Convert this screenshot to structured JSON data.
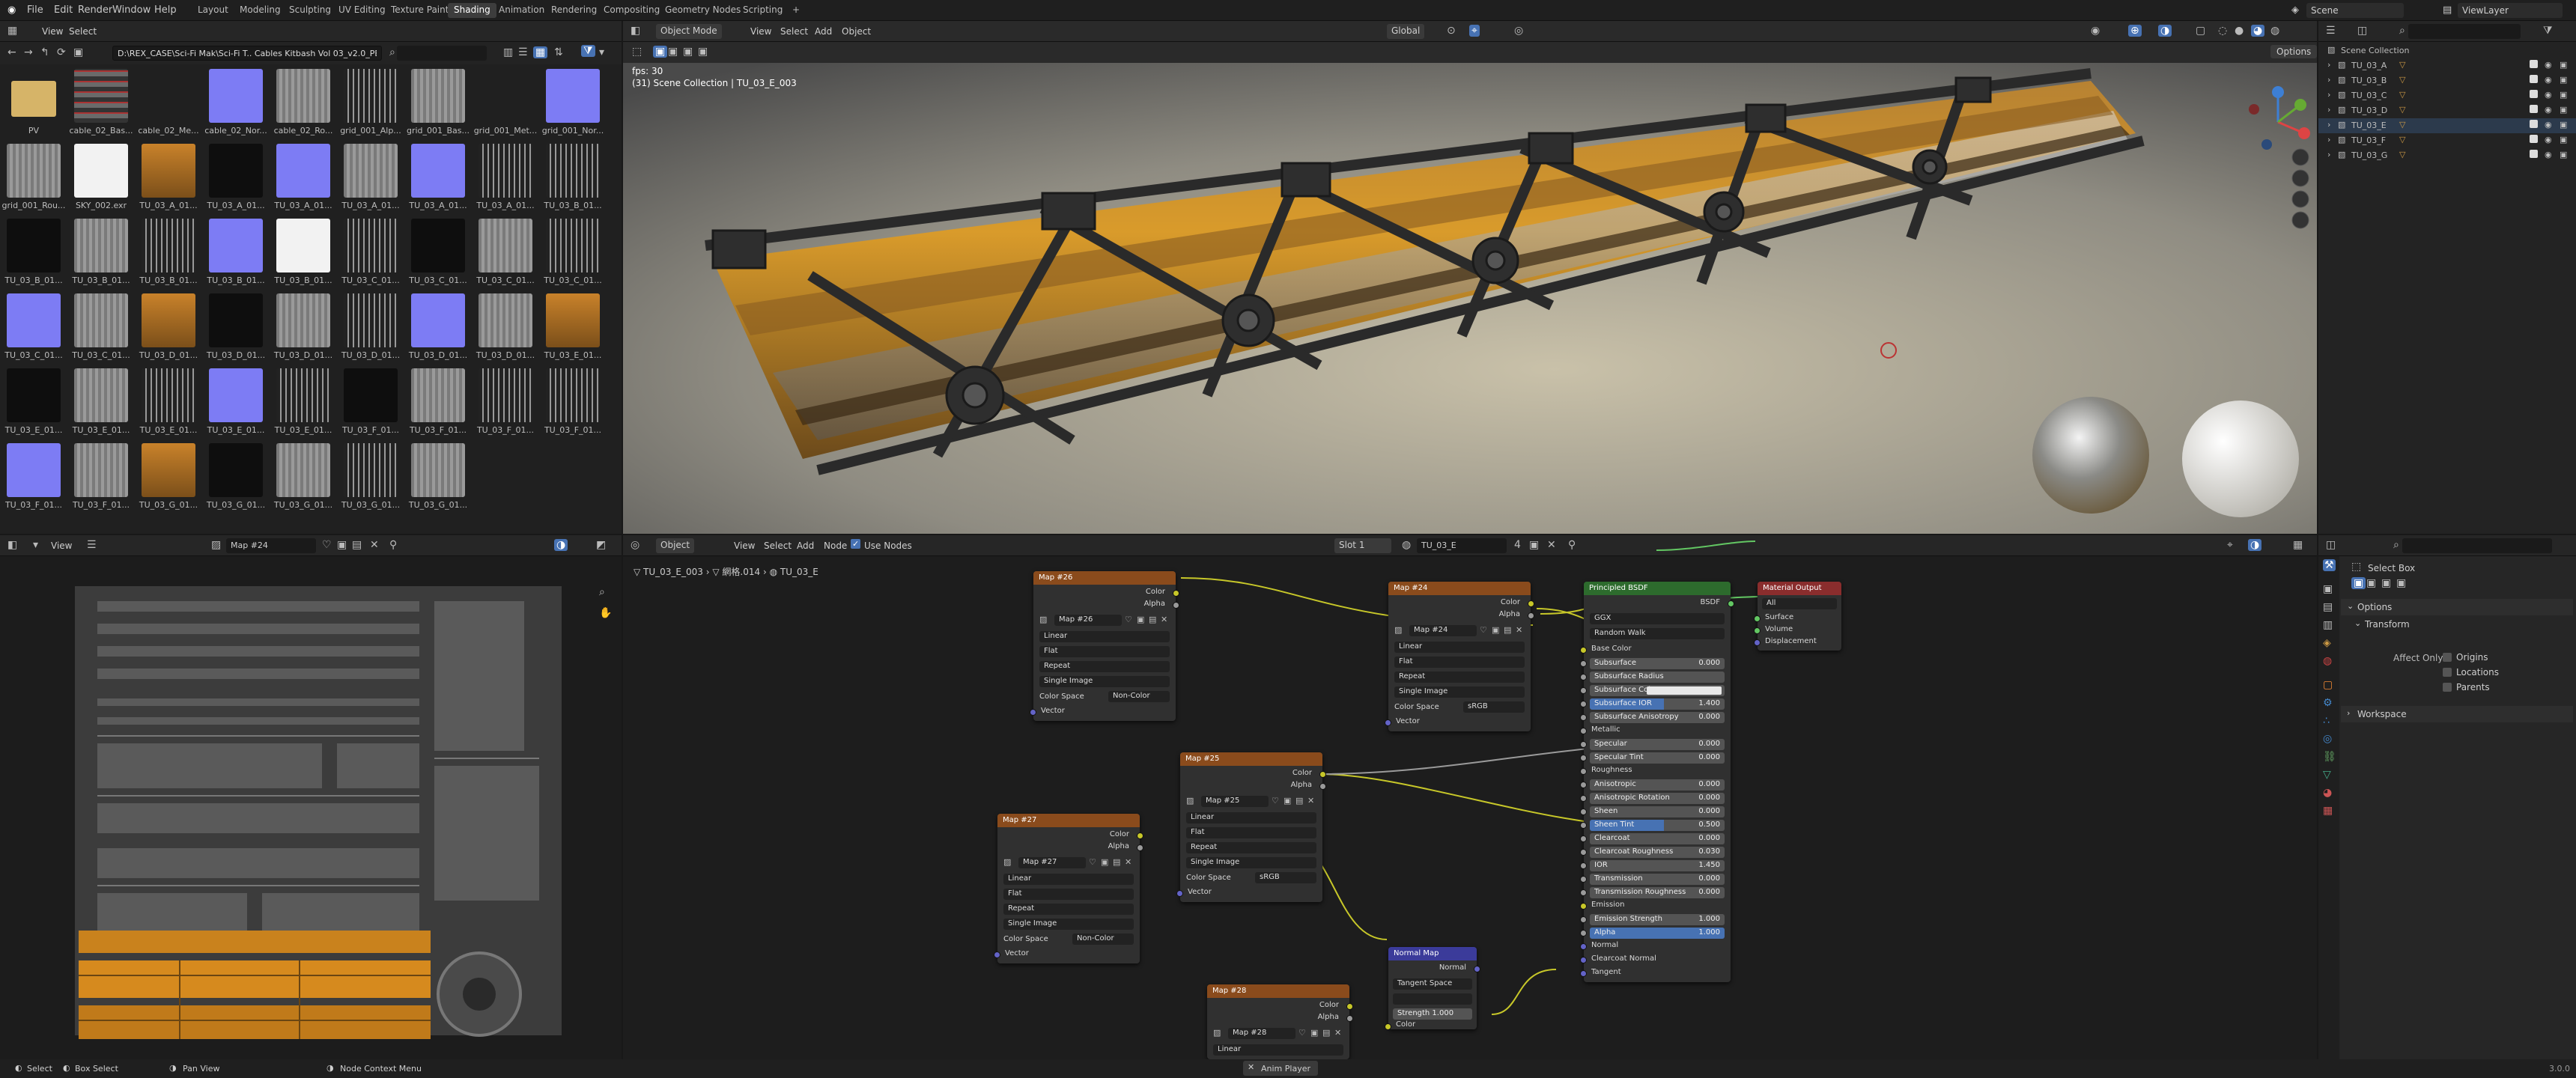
{
  "topbar": {
    "menus": [
      "File",
      "Edit",
      "Render",
      "Window",
      "Help"
    ],
    "workspaces": [
      "Layout",
      "Modeling",
      "Sculpting",
      "UV Editing",
      "Texture Paint",
      "Shading",
      "Animation",
      "Rendering",
      "Compositing",
      "Geometry Nodes",
      "Scripting"
    ],
    "active_workspace": "Shading",
    "add": "+",
    "scene": "Scene",
    "view_layer": "ViewLayer"
  },
  "filebrowser": {
    "menus": [
      "View",
      "Select"
    ],
    "path": "D:\\REX_CASE\\Sci-Fi Mak\\Sci-Fi T.. Cables Kitbash Vol 03_v2.0_PBR\\",
    "items": [
      {
        "label": "PV",
        "kind": "folder"
      },
      {
        "label": "cable_02_Bas...",
        "kind": "stripes"
      },
      {
        "label": "cable_02_Me...",
        "kind": "dark"
      },
      {
        "label": "cable_02_Nor...",
        "kind": "normal"
      },
      {
        "label": "cable_02_Ro...",
        "kind": "grey"
      },
      {
        "label": "grid_001_Alp...",
        "kind": "grid"
      },
      {
        "label": "grid_001_Bas...",
        "kind": "grey"
      },
      {
        "label": "grid_001_Met...",
        "kind": "dark"
      },
      {
        "label": "grid_001_Nor...",
        "kind": "normal"
      },
      {
        "label": "grid_001_Rou...",
        "kind": "grey"
      },
      {
        "label": "SKY_002.exr",
        "kind": "white"
      },
      {
        "label": "TU_03_A_01...",
        "kind": "orange"
      },
      {
        "label": "TU_03_A_01...",
        "kind": "black"
      },
      {
        "label": "TU_03_A_01...",
        "kind": "normal"
      },
      {
        "label": "TU_03_A_01...",
        "kind": "grey"
      },
      {
        "label": "TU_03_A_01...",
        "kind": "normal"
      },
      {
        "label": "TU_03_A_01...",
        "kind": "grid"
      },
      {
        "label": "TU_03_B_01...",
        "kind": "grid"
      },
      {
        "label": "TU_03_B_01...",
        "kind": "black"
      },
      {
        "label": "TU_03_B_01...",
        "kind": "grey"
      },
      {
        "label": "TU_03_B_01...",
        "kind": "grid"
      },
      {
        "label": "TU_03_B_01...",
        "kind": "normal"
      },
      {
        "label": "TU_03_B_01...",
        "kind": "white"
      },
      {
        "label": "TU_03_C_01...",
        "kind": "grid"
      },
      {
        "label": "TU_03_C_01...",
        "kind": "black"
      },
      {
        "label": "TU_03_C_01...",
        "kind": "grey"
      },
      {
        "label": "TU_03_C_01...",
        "kind": "grid"
      },
      {
        "label": "TU_03_C_01...",
        "kind": "normal"
      },
      {
        "label": "TU_03_C_01...",
        "kind": "grey"
      },
      {
        "label": "TU_03_D_01...",
        "kind": "orange"
      },
      {
        "label": "TU_03_D_01...",
        "kind": "black"
      },
      {
        "label": "TU_03_D_01...",
        "kind": "grey"
      },
      {
        "label": "TU_03_D_01...",
        "kind": "grid"
      },
      {
        "label": "TU_03_D_01...",
        "kind": "normal"
      },
      {
        "label": "TU_03_D_01...",
        "kind": "grey"
      },
      {
        "label": "TU_03_E_01...",
        "kind": "orange"
      },
      {
        "label": "TU_03_E_01...",
        "kind": "black"
      },
      {
        "label": "TU_03_E_01...",
        "kind": "grey"
      },
      {
        "label": "TU_03_E_01...",
        "kind": "grid"
      },
      {
        "label": "TU_03_E_01...",
        "kind": "normal"
      },
      {
        "label": "TU_03_E_01...",
        "kind": "grid"
      },
      {
        "label": "TU_03_F_01...",
        "kind": "black"
      },
      {
        "label": "TU_03_F_01...",
        "kind": "grey"
      },
      {
        "label": "TU_03_F_01...",
        "kind": "grid"
      },
      {
        "label": "TU_03_F_01...",
        "kind": "grid"
      },
      {
        "label": "TU_03_F_01...",
        "kind": "normal"
      },
      {
        "label": "TU_03_F_01...",
        "kind": "grey"
      },
      {
        "label": "TU_03_G_01...",
        "kind": "orange"
      },
      {
        "label": "TU_03_G_01...",
        "kind": "black"
      },
      {
        "label": "TU_03_G_01...",
        "kind": "grey"
      },
      {
        "label": "TU_03_G_01...",
        "kind": "grid"
      },
      {
        "label": "TU_03_G_01...",
        "kind": "grey"
      }
    ]
  },
  "viewport": {
    "mode": "Object Mode",
    "menus": [
      "View",
      "Select",
      "Add",
      "Object"
    ],
    "orientation": "Global",
    "options": "Options",
    "fps": "fps: 30",
    "collection": "(31) Scene Collection | TU_03_E_003"
  },
  "outliner": {
    "title": "Scene Collection",
    "items": [
      "TU_03_A",
      "TU_03_B",
      "TU_03_C",
      "TU_03_D",
      "TU_03_E",
      "TU_03_F",
      "TU_03_G"
    ]
  },
  "uv": {
    "view": "View",
    "image": "Map #24"
  },
  "node_editor": {
    "object": "Object",
    "menus": [
      "View",
      "Select",
      "Add",
      "Node"
    ],
    "use_nodes": "Use Nodes",
    "slot": "Slot 1",
    "material": "TU_03_E",
    "breadcrumb": [
      "TU_03_E_003",
      "網格.014",
      "TU_03_E"
    ]
  },
  "nodes": {
    "map26": {
      "title": "Map #26",
      "img": "Map #26",
      "out1": "Color",
      "out2": "Alpha",
      "interp": "Linear",
      "proj": "Flat",
      "ext": "Repeat",
      "src": "Single Image",
      "cs_label": "Color Space",
      "cs": "Non-Color",
      "vec": "Vector"
    },
    "map24": {
      "title": "Map #24",
      "img": "Map #24",
      "out1": "Color",
      "out2": "Alpha",
      "interp": "Linear",
      "proj": "Flat",
      "ext": "Repeat",
      "src": "Single Image",
      "cs_label": "Color Space",
      "cs": "sRGB",
      "vec": "Vector"
    },
    "map25": {
      "title": "Map #25",
      "img": "Map #25",
      "out1": "Color",
      "out2": "Alpha",
      "interp": "Linear",
      "proj": "Flat",
      "ext": "Repeat",
      "src": "Single Image",
      "cs_label": "Color Space",
      "cs": "sRGB",
      "vec": "Vector"
    },
    "map27": {
      "title": "Map #27",
      "img": "Map #27",
      "out1": "Color",
      "out2": "Alpha",
      "interp": "Linear",
      "proj": "Flat",
      "ext": "Repeat",
      "src": "Single Image",
      "cs_label": "Color Space",
      "cs": "Non-Color",
      "vec": "Vector"
    },
    "map28": {
      "title": "Map #28",
      "img": "Map #28",
      "out1": "Color",
      "out2": "Alpha",
      "interp": "Linear"
    },
    "normal": {
      "title": "Normal Map",
      "out": "Normal",
      "space": "Tangent Space",
      "strength_label": "Strength",
      "strength": "1.000",
      "color": "Color"
    },
    "bsdf": {
      "title": "Principled BSDF",
      "out": "BSDF",
      "dist": "GGX",
      "sss": "Random Walk",
      "base": "Base Color",
      "fields": [
        [
          "Subsurface",
          "0.000"
        ],
        [
          "Subsurface Radius",
          ""
        ],
        [
          "Subsurface Color",
          ""
        ],
        [
          "Subsurface IOR",
          "1.400"
        ],
        [
          "Subsurface Anisotropy",
          "0.000"
        ]
      ],
      "metallic": "Metallic",
      "fields2": [
        [
          "Specular",
          "0.000"
        ],
        [
          "Specular Tint",
          "0.000"
        ]
      ],
      "roughness": "Roughness",
      "fields3": [
        [
          "Anisotropic",
          "0.000"
        ],
        [
          "Anisotropic Rotation",
          "0.000"
        ],
        [
          "Sheen",
          "0.000"
        ],
        [
          "Sheen Tint",
          "0.500"
        ],
        [
          "Clearcoat",
          "0.000"
        ],
        [
          "Clearcoat Roughness",
          "0.030"
        ],
        [
          "IOR",
          "1.450"
        ],
        [
          "Transmission",
          "0.000"
        ],
        [
          "Transmission Roughness",
          "0.000"
        ]
      ],
      "emission": "Emission",
      "fields4": [
        [
          "Emission Strength",
          "1.000"
        ],
        [
          "Alpha",
          "1.000"
        ]
      ],
      "normal": "Normal",
      "cnormal": "Clearcoat Normal",
      "tangent": "Tangent"
    },
    "output": {
      "title": "Material Output",
      "target": "All",
      "surface": "Surface",
      "volume": "Volume",
      "disp": "Displacement"
    }
  },
  "properties": {
    "tool": "Select Box",
    "options": "Options",
    "transform": "Transform",
    "affect_only": "Affect Only",
    "origins": "Origins",
    "locations": "Locations",
    "parents": "Parents",
    "workspace": "Workspace"
  },
  "statusbar": {
    "select": "Select",
    "box_select": "Box Select",
    "pan_view": "Pan View",
    "node_context": "Node Context Menu",
    "anim_player": "Anim Player",
    "version": "3.0.0"
  }
}
